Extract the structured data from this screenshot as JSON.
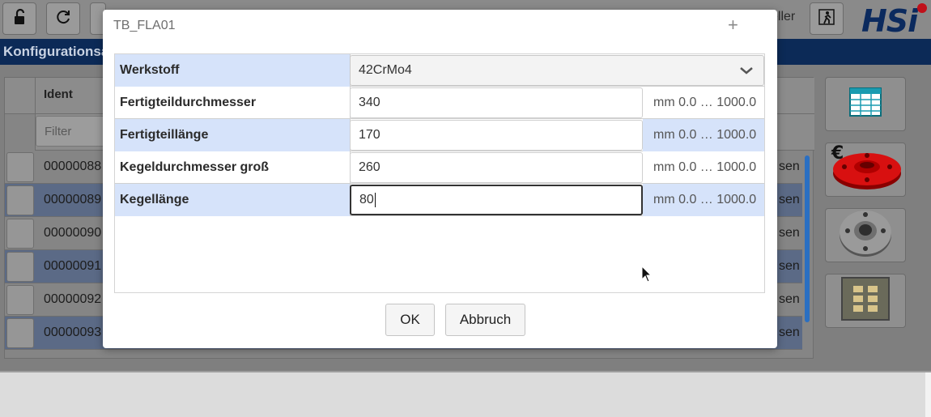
{
  "app": {
    "user_label": "eller",
    "logo_text": "HSi",
    "nav_title": "Konfigurationsa",
    "grid": {
      "column_ident": "Ident",
      "filter_placeholder": "Filter",
      "rows": [
        {
          "ident": "00000088",
          "tail": "sen"
        },
        {
          "ident": "00000089",
          "tail": "sen"
        },
        {
          "ident": "00000090",
          "tail": "sen"
        },
        {
          "ident": "00000091",
          "tail": "sen"
        },
        {
          "ident": "00000092",
          "tail": "sen"
        },
        {
          "ident": "00000093",
          "tail": "sen"
        }
      ]
    }
  },
  "dialog": {
    "title": "TB_FLA01",
    "close_label": "+",
    "fields": [
      {
        "label": "Werkstoff",
        "value": "42CrMo4",
        "unit": ""
      },
      {
        "label": "Fertigteildurchmesser",
        "value": "340",
        "unit": "mm 0.0 … 1000.0"
      },
      {
        "label": "Fertigteillänge",
        "value": "170",
        "unit": "mm 0.0 … 1000.0"
      },
      {
        "label": "Kegeldurchmesser groß",
        "value": "260",
        "unit": "mm 0.0 … 1000.0"
      },
      {
        "label": "Kegellänge",
        "value": "80",
        "unit": "mm 0.0 … 1000.0"
      }
    ],
    "ok_label": "OK",
    "cancel_label": "Abbruch"
  },
  "colors": {
    "navbar": "#0c2a57",
    "row_highlight": "#d6e3fa",
    "logo_dot": "#c0101a"
  }
}
